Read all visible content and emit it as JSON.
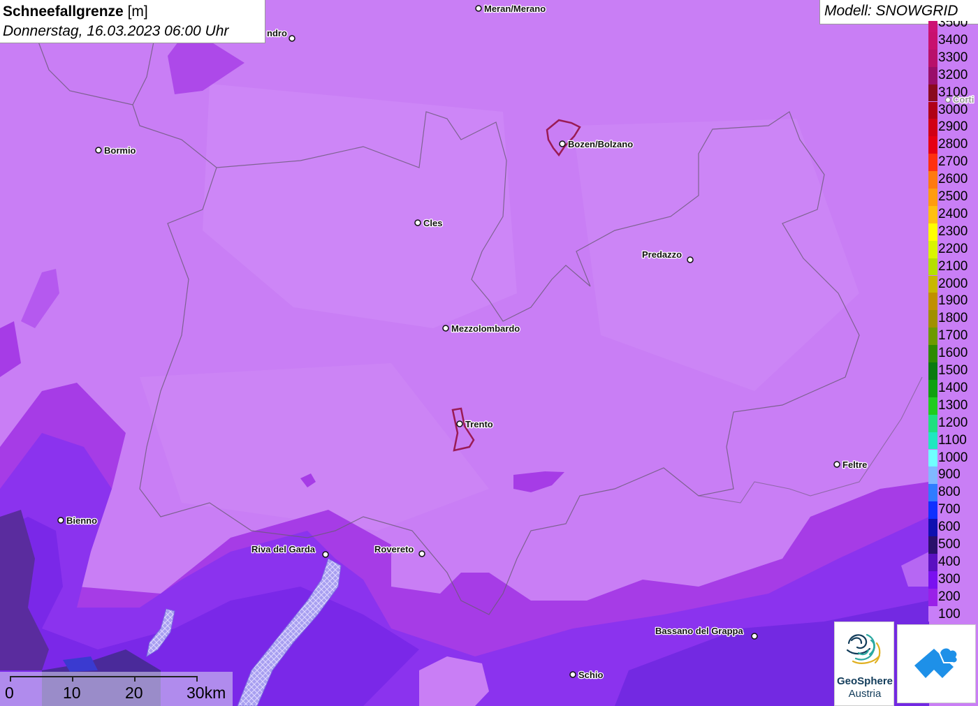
{
  "header": {
    "title": "Schneefallgrenze",
    "unit": "[m]",
    "datetime": "Donnerstag, 16.03.2023 06:00 Uhr"
  },
  "model": {
    "label": "Modell: SNOWGRID"
  },
  "cities": [
    {
      "name": "Meran/Merano"
    },
    {
      "name": "ndro"
    },
    {
      "name": "Bozen/Bolzano"
    },
    {
      "name": "Bormio"
    },
    {
      "name": "Cles"
    },
    {
      "name": "Predazzo"
    },
    {
      "name": "Mezzolombardo"
    },
    {
      "name": "Trento"
    },
    {
      "name": "Feltre"
    },
    {
      "name": "Bienno"
    },
    {
      "name": "Riva del Garda"
    },
    {
      "name": "Rovereto"
    },
    {
      "name": "Bassano del Grappa"
    },
    {
      "name": "Schio"
    },
    {
      "name": "Corti"
    }
  ],
  "legend": {
    "items": [
      {
        "label": "3500",
        "color": "#cc1173"
      },
      {
        "label": "3400",
        "color": "#c8116e"
      },
      {
        "label": "3300",
        "color": "#b8106a"
      },
      {
        "label": "3200",
        "color": "#990e69"
      },
      {
        "label": "3100",
        "color": "#8a0a1e"
      },
      {
        "label": "3000",
        "color": "#b00016"
      },
      {
        "label": "2900",
        "color": "#d10015"
      },
      {
        "label": "2800",
        "color": "#e60012"
      },
      {
        "label": "2700",
        "color": "#ff3010"
      },
      {
        "label": "2600",
        "color": "#ff7a10"
      },
      {
        "label": "2500",
        "color": "#ff9c10"
      },
      {
        "label": "2400",
        "color": "#ffc010"
      },
      {
        "label": "2300",
        "color": "#ffff00"
      },
      {
        "label": "2200",
        "color": "#d9f500"
      },
      {
        "label": "2100",
        "color": "#b5e000"
      },
      {
        "label": "2000",
        "color": "#c8b800"
      },
      {
        "label": "1900",
        "color": "#c09000"
      },
      {
        "label": "1800",
        "color": "#a09000"
      },
      {
        "label": "1700",
        "color": "#6c9a00"
      },
      {
        "label": "1600",
        "color": "#2e8a00"
      },
      {
        "label": "1500",
        "color": "#0a7a10"
      },
      {
        "label": "1400",
        "color": "#10a010"
      },
      {
        "label": "1300",
        "color": "#20cc20"
      },
      {
        "label": "1200",
        "color": "#20e080"
      },
      {
        "label": "1100",
        "color": "#20e8c0"
      },
      {
        "label": "1000",
        "color": "#70ffff"
      },
      {
        "label": "900",
        "color": "#80b8ff"
      },
      {
        "label": "800",
        "color": "#2f7cff"
      },
      {
        "label": "700",
        "color": "#1030ff"
      },
      {
        "label": "600",
        "color": "#1010b0"
      },
      {
        "label": "500",
        "color": "#2a106a"
      },
      {
        "label": "400",
        "color": "#5a10c0"
      },
      {
        "label": "300",
        "color": "#7a10f0"
      },
      {
        "label": "200",
        "color": "#9a20e8"
      },
      {
        "label": "100",
        "color": "#c87ef8"
      }
    ]
  },
  "scalebar": {
    "labels": [
      "0",
      "10",
      "20",
      "30km"
    ]
  },
  "logos": {
    "geosphere_line1": "GeoSphere",
    "geosphere_line2": "Austria"
  }
}
